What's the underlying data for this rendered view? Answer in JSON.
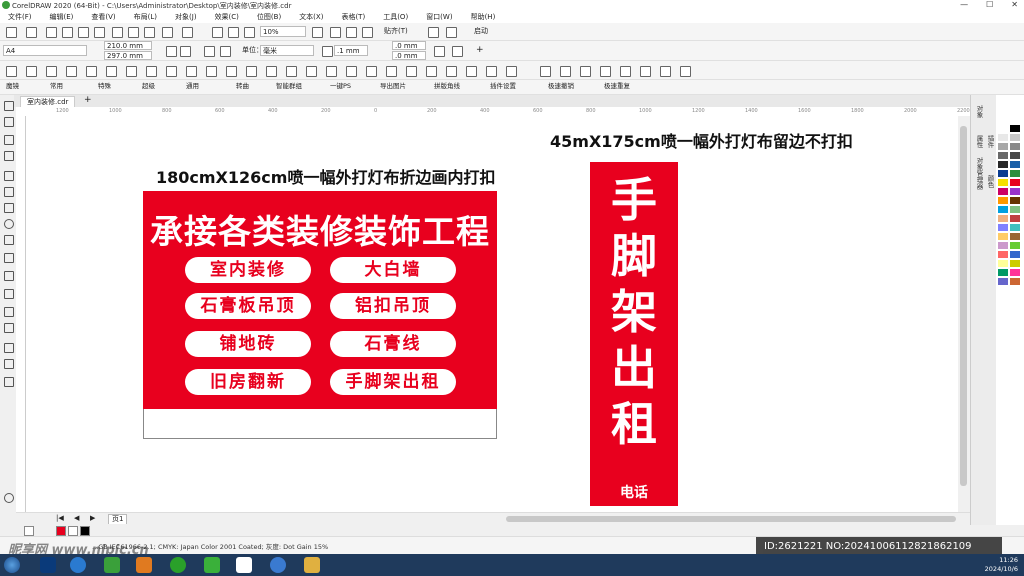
{
  "window": {
    "title": "CorelDRAW 2020 (64-Bit) - C:\\Users\\Administrator\\Desktop\\室内装修\\室内装修.cdr",
    "controls": [
      "—",
      "☐",
      "✕"
    ]
  },
  "menu": [
    "文件(F)",
    "编辑(E)",
    "查看(V)",
    "布局(L)",
    "对象(J)",
    "效果(C)",
    "位图(B)",
    "文本(X)",
    "表格(T)",
    "工具(O)",
    "窗口(W)",
    "帮助(H)"
  ],
  "toolbar1": {
    "zoom": "10%",
    "snap": "贴齐(T)",
    "launch": "启动"
  },
  "toolbar2": {
    "page_size": "A4",
    "width": "210.0 mm",
    "height": "297.0 mm",
    "units_label": "单位：",
    "units": "毫米",
    "nudge": ".1 mm",
    "dup_x": ".0 mm",
    "dup_y": ".0 mm"
  },
  "plugins": [
    "魔镜",
    "常用",
    "特殊",
    "超级",
    "通用",
    "转曲",
    "智能群组",
    "一键PS",
    "导出图片",
    "拼版角线",
    "插件设置",
    "极速撤销",
    "极速重复"
  ],
  "document_tab": "室内装修.cdr",
  "ruler_ticks": [
    "1200",
    "1000",
    "800",
    "600",
    "400",
    "200",
    "0",
    "200",
    "400",
    "600",
    "800",
    "1000",
    "1200",
    "1400",
    "1600",
    "1800",
    "2000",
    "2200"
  ],
  "design": {
    "caption_left": "180cmX126cm喷一幅外打灯布折边画内打扣",
    "caption_right": "45mX175cm喷一幅外打灯布留边不打扣",
    "headline": "承接各类装修装饰工程",
    "services": [
      "室内装修",
      "大白墙",
      "石膏板吊顶",
      "铝扣吊顶",
      "铺地砖",
      "石膏线",
      "旧房翻新",
      "手脚架出租"
    ],
    "banner_chars": [
      "手",
      "脚",
      "架",
      "出",
      "租"
    ],
    "banner_phone": "电话",
    "red": "#e8001e"
  },
  "page_nav": {
    "page_label": "页1"
  },
  "dockers": [
    "对象",
    "属性",
    "对象管理器",
    "插件",
    "颜色"
  ],
  "status": {
    "profile": "...GB IEC61966-2.1; CMYK: Japan Color 2001 Coated; 灰度: Dot Gain 15%",
    "watermark": "昵享网 www.nipic.cn",
    "image_id": "ID:2621221 NO:20241006112821862109"
  },
  "clock": {
    "time": "11:26",
    "date": "2024/10/6"
  },
  "palette_colors": [
    "#ffffff",
    "#000000",
    "#e8e8e8",
    "#c8c8c8",
    "#a8a8a8",
    "#888888",
    "#686868",
    "#484848",
    "#282828",
    "#1a5fa8",
    "#0b3d91",
    "#2d8f3e",
    "#f5e000",
    "#e8001e",
    "#cc0066",
    "#9933cc",
    "#ff9900",
    "#663300",
    "#00a0e0",
    "#80c080",
    "#f0b080",
    "#c04040",
    "#8080ff",
    "#40c0c0",
    "#ffcc66",
    "#996633",
    "#cc99cc",
    "#66cc33",
    "#ff6666",
    "#3366cc",
    "#ffff99",
    "#cccc00",
    "#009966",
    "#ff3399",
    "#6666cc",
    "#cc6633"
  ]
}
